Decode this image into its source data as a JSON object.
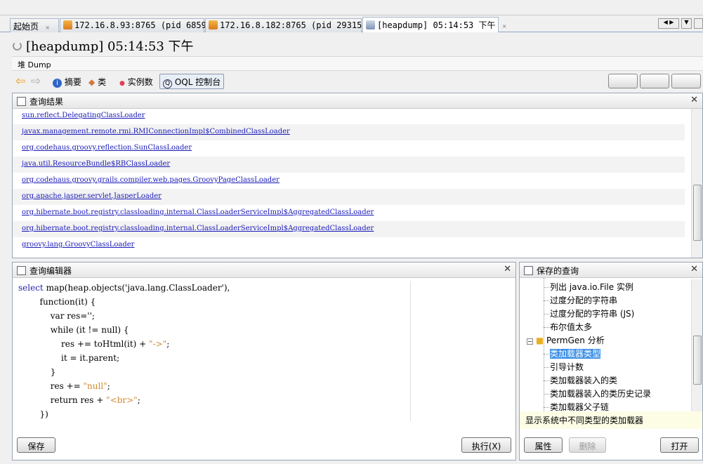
{
  "tabs": [
    {
      "label": "起始页",
      "icon": "home-icon"
    },
    {
      "label": "172.16.8.93:8765 (pid 6859)",
      "icon": "jmx-icon"
    },
    {
      "label": "172.16.8.182:8765 (pid 29315)",
      "icon": "jmx-icon"
    },
    {
      "label": "[heapdump] 05:14:53 下午",
      "icon": "heapdump-icon",
      "active": true
    }
  ],
  "title": "[heapdump] 05:14:53 下午",
  "heap_bar": "堆 Dump",
  "toolbar": {
    "summary": "摘要",
    "classes": "类",
    "instances": "实例数",
    "oql": "OQL 控制台"
  },
  "results": {
    "title": "查询结果",
    "items": [
      "sun.reflect.DelegatingClassLoader",
      "javax.management.remote.rmi.RMIConnectionImpl$CombinedClassLoader",
      "org.codehaus.groovy.reflection.SunClassLoader",
      "java.util.ResourceBundle$RBClassLoader",
      "org.codehaus.groovy.grails.compiler.web.pages.GroovyPageClassLoader",
      "org.apache.jasper.servlet.JasperLoader",
      "org.hibernate.boot.registry.classloading.internal.ClassLoaderServiceImpl$AggregatedClassLoader",
      "org.hibernate.boot.registry.classloading.internal.ClassLoaderServiceImpl$AggregatedClassLoader",
      "groovy.lang.GroovyClassLoader"
    ]
  },
  "editor": {
    "title": "查询编辑器",
    "save": "保存",
    "run": "执行(X)",
    "lines": [
      [
        {
          "t": "select",
          "c": "kw"
        },
        {
          "t": " map(heap.objects('java.lang.ClassLoader'),"
        }
      ],
      [
        {
          "t": "        function(it) {"
        }
      ],
      [
        {
          "t": "            var res='';"
        }
      ],
      [
        {
          "t": "            while (it != null) {"
        }
      ],
      [
        {
          "t": "                res += toHtml(it) + "
        },
        {
          "t": "\"->\"",
          "c": "str"
        },
        {
          "t": ";"
        }
      ],
      [
        {
          "t": "                it = it.parent;"
        }
      ],
      [
        {
          "t": "            }"
        }
      ],
      [
        {
          "t": "            res += "
        },
        {
          "t": "\"null\"",
          "c": "str"
        },
        {
          "t": ";"
        }
      ],
      [
        {
          "t": "            return res + "
        },
        {
          "t": "\"<br>\"",
          "c": "str"
        },
        {
          "t": ";"
        }
      ],
      [
        {
          "t": "        })"
        }
      ]
    ]
  },
  "saved": {
    "title": "保存的查询",
    "items": [
      {
        "label": "列出 java.io.File 实例",
        "level": 2
      },
      {
        "label": "过度分配的字符串",
        "level": 2
      },
      {
        "label": "过度分配的字符串 (JS)",
        "level": 2
      },
      {
        "label": "布尔值太多",
        "level": 2
      },
      {
        "label": "PermGen 分析",
        "level": 1,
        "folder": true
      },
      {
        "label": "类加载器类型",
        "level": 2,
        "selected": true
      },
      {
        "label": "引导计数",
        "level": 2
      },
      {
        "label": "类加载器装入的类",
        "level": 2
      },
      {
        "label": "类加载器装入的类历史记录",
        "level": 2
      },
      {
        "label": "类加载器父子链",
        "level": 2
      }
    ],
    "description": "显示系统中不同类型的类加载器",
    "properties": "属性",
    "delete": "删除",
    "open": "打开"
  }
}
